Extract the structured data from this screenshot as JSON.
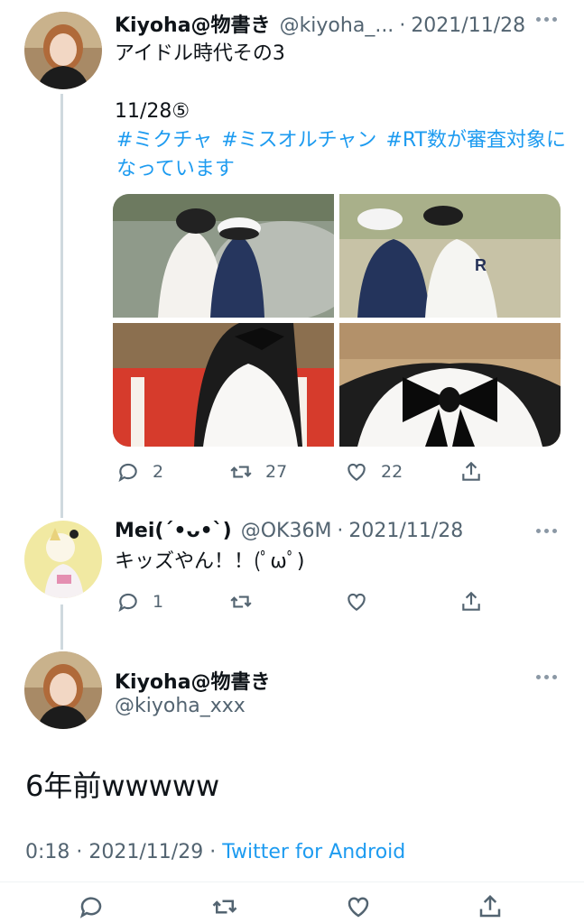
{
  "tweet1": {
    "name": "Kiyoha@物書き",
    "handle": "@kiyoha_...",
    "dot": "·",
    "date": "2021/11/28",
    "text_line1": "アイドル時代その3",
    "text_line2": "11/28⑤",
    "hashtag1": "#ミクチャ",
    "hashtag2": "#ミスオルチャン",
    "hashtag3": "#RT数が審査対象になっています",
    "replies": "2",
    "retweets": "27",
    "likes": "22"
  },
  "tweet2": {
    "name": "Mei(ˊ•ᴗ•ˋ)",
    "handle": "@OK36M",
    "dot": "·",
    "date": "2021/11/28",
    "text": "キッズやん！！(ﾟωﾟ)",
    "replies": "1"
  },
  "tweet3": {
    "name": "Kiyoha@物書き",
    "handle": "@kiyoha_xxx",
    "text": "6年前wwwww",
    "time": "0:18",
    "dot": "·",
    "date": "2021/11/29",
    "dot2": "·",
    "source": "Twitter for Android"
  },
  "colors": {
    "accent": "#1d9bf0",
    "secondary_text": "#536471",
    "thread_line": "#cfd9de"
  },
  "icons": [
    "more-icon",
    "reply-icon",
    "retweet-icon",
    "like-icon",
    "share-icon"
  ]
}
